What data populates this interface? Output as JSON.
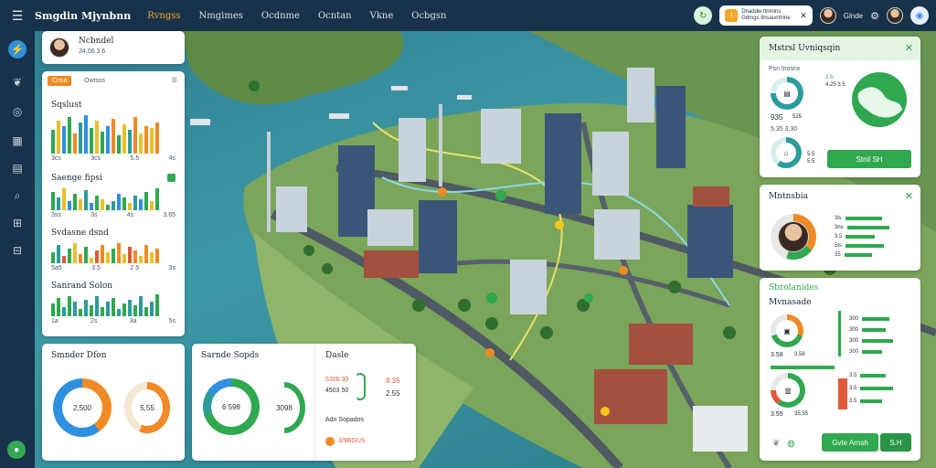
{
  "app": {
    "title": "Smgdin Mjynbnn"
  },
  "nav": [
    {
      "label": "Rvngss",
      "active": true
    },
    {
      "label": "Nmgimes",
      "active": false
    },
    {
      "label": "Ocdnme",
      "active": false
    },
    {
      "label": "Ocntan",
      "active": false
    },
    {
      "label": "Vkne",
      "active": false
    },
    {
      "label": "Ocbgsn",
      "active": false
    }
  ],
  "alert": {
    "text": "Dnaddw ttnmlns Gdmgs tlnsaumhlne"
  },
  "user": {
    "name": "Glnde"
  },
  "profile_card": {
    "name": "Ncbndel",
    "meta": "24.06   3   6"
  },
  "panel_left": {
    "tab_active": "Cnsa",
    "tab_other": "Owtsss",
    "sections": [
      {
        "title": "Sqslust",
        "labels": [
          "3cs",
          "3cs",
          "5.5",
          "4s"
        ]
      },
      {
        "title": "Saenge fipsi",
        "labels": [
          "3ss",
          "3s",
          "4s",
          "3.65"
        ]
      },
      {
        "title": "Svdasne dsnd",
        "labels": [
          "5a5",
          "3.5",
          "2.5",
          "3s"
        ]
      },
      {
        "title": "Sanrand Solon",
        "labels": [
          "1a",
          "2s",
          "3a",
          "5s"
        ]
      }
    ]
  },
  "donut_card_1": {
    "title": "Smnder Dfon",
    "value_a": "2,500",
    "value_b": "5,55"
  },
  "donut_card_2": {
    "title": "Sarnde Sopds",
    "value_a": "6 598",
    "value_b": "3098",
    "side_title": "Dasle",
    "side_rows": [
      "5300 30",
      "4503 50"
    ],
    "side_values": [
      "8.35",
      "2.55"
    ],
    "footer_title": "Adn Sopados",
    "footer_link": "3/9BGUS"
  },
  "right_card_1": {
    "title": "Mstrsl Uvniqsqin",
    "row1_title": "Psn  lnosnx",
    "row1_values": [
      "935",
      "525"
    ],
    "row1_small": [
      "2.5",
      "4.25  3.5"
    ],
    "row2_small": "5.35  3.30",
    "row2_values": [
      "5.5",
      "5.5"
    ],
    "button_label": "Stnil  SH"
  },
  "right_card_2": {
    "title": "Mntnsbia",
    "bars": [
      "3ls",
      "3ns",
      "3.5",
      "5ts",
      "35"
    ]
  },
  "right_card_3": {
    "title": "Sbrolanides",
    "subtitle": "Mvnasade",
    "values_a": [
      "3.58",
      "3.58"
    ],
    "values_b": [
      "3.55",
      "35.55"
    ],
    "rows": [
      "300",
      "300",
      "300",
      "300",
      "3.5",
      "3.5",
      "3.5"
    ],
    "button_a": "Gvte Arnsh",
    "button_b": "S.H"
  },
  "colors": {
    "accent_green": "#2fa84f",
    "accent_orange": "#f08a24",
    "accent_blue": "#2f8fe0",
    "bar_teal": "#2c9c9a",
    "bar_yellow": "#e8c02a",
    "bar_red": "#e05a3a",
    "topbar_bg": "#17324a"
  },
  "icons": [
    "menu-icon",
    "bolt-icon",
    "leaf-icon",
    "target-icon",
    "calendar-icon",
    "document-icon",
    "search-icon",
    "grid-icon",
    "folder-icon",
    "bell-icon",
    "chrome-icon"
  ]
}
